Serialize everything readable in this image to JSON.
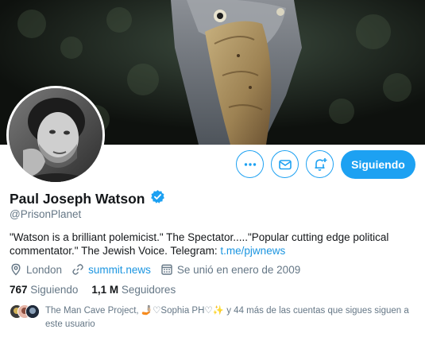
{
  "profile": {
    "name": "Paul Joseph Watson",
    "verified_icon": "verified-badge-icon",
    "handle": "@PrisonPlanet",
    "bio_text": "\"Watson is a brilliant polemicist.\" The Spectator.....\"Popular cutting edge political commentator.\" The Jewish Voice. Telegram: ",
    "bio_link": "t.me/pjwnews",
    "location": "London",
    "website": "summit.news",
    "joined": "Se unió en enero de 2009"
  },
  "actions": {
    "more_icon": "more-dots-icon",
    "message_icon": "envelope-icon",
    "notify_icon": "bell-plus-icon",
    "follow_label": "Siguiendo"
  },
  "stats": {
    "following_count": "767",
    "following_label": "Siguiendo",
    "followers_count": "1,1 M",
    "followers_label": "Seguidores"
  },
  "followed_by": {
    "names": "The Man Cave Project,  🤳🏼♡Sophia PH♡✨",
    "suffix": " y 44 más de las cuentas que sigues siguen a este usuario"
  },
  "colors": {
    "accent": "#1da1f2",
    "link": "#1b95e0",
    "secondary_text": "#657786"
  }
}
